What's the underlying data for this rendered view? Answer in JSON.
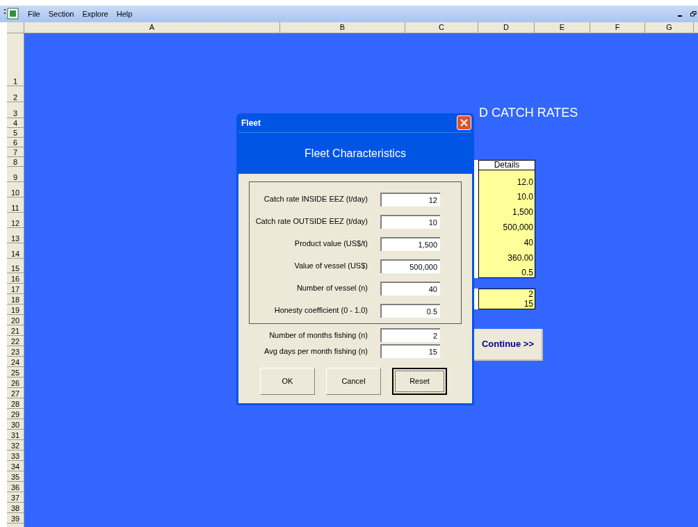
{
  "menu": [
    "File",
    "Section",
    "Explore",
    "Help"
  ],
  "columns": [
    "A",
    "B",
    "C",
    "D",
    "E",
    "F",
    "G"
  ],
  "rows": [
    "1",
    "2",
    "3",
    "4",
    "5",
    "6",
    "7",
    "8",
    "9",
    "10",
    "11",
    "12",
    "13",
    "14",
    "15",
    "16",
    "17",
    "18",
    "19",
    "20",
    "21",
    "22",
    "23",
    "24",
    "25",
    "26",
    "27",
    "28",
    "29",
    "30",
    "31",
    "32",
    "33",
    "34",
    "35",
    "36",
    "37",
    "38",
    "39"
  ],
  "sheet": {
    "title": "D CATCH RATES",
    "details_header": "Details",
    "details": [
      "12.0",
      "10.0",
      "1,500",
      "500,000",
      "40",
      "360.00",
      "0.5"
    ],
    "details_2": [
      "2",
      "15"
    ],
    "continue_button": "Continue >>"
  },
  "dialog": {
    "title": "Fleet",
    "heading": "Fleet Characteristics",
    "group_fields": [
      {
        "label": "Catch rate INSIDE EEZ (t/day)",
        "value": "12"
      },
      {
        "label": "Catch rate OUTSIDE EEZ (t/day)",
        "value": "10"
      },
      {
        "label": "Product value  (US$/t)",
        "value": "1,500"
      },
      {
        "label": "Value of vessel  (US$)",
        "value": "500,000"
      },
      {
        "label": "Number of vessel (n)",
        "value": "40"
      },
      {
        "label": "Honesty coefficient (0 - 1.0)",
        "value": "0.5"
      }
    ],
    "fields": [
      {
        "label": "Number of months fishing (n)",
        "value": "2"
      },
      {
        "label": "Avg days per month fishing (n)",
        "value": "15"
      }
    ],
    "buttons": [
      {
        "label": "OK",
        "focused": false
      },
      {
        "label": "Cancel",
        "focused": false
      },
      {
        "label": "Reset",
        "focused": true
      }
    ]
  }
}
